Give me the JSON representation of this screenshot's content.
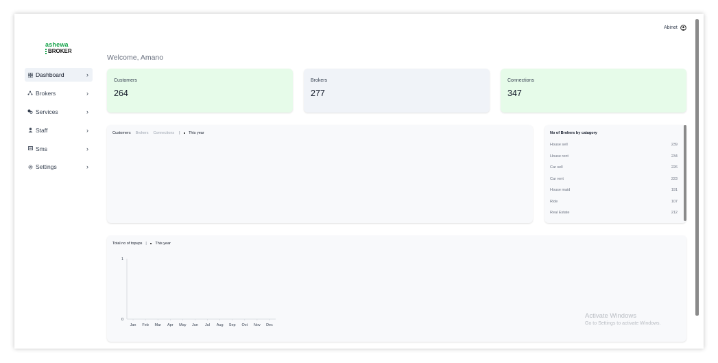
{
  "brand": {
    "top": "ashewa",
    "bottom": "BROKER",
    "accent": "#16a34a"
  },
  "user": {
    "name": "Abinet",
    "icon": "user-circle-icon"
  },
  "welcome": "Welcome, Amano",
  "sidebar": {
    "items": [
      {
        "label": "Dashboard",
        "icon": "grid-icon",
        "active": true
      },
      {
        "label": "Brokers",
        "icon": "branch-icon"
      },
      {
        "label": "Services",
        "icon": "services-icon"
      },
      {
        "label": "Staff",
        "icon": "person-icon"
      },
      {
        "label": "Sms",
        "icon": "message-icon"
      },
      {
        "label": "Settings",
        "icon": "gear-icon"
      }
    ]
  },
  "stats": [
    {
      "label": "Customers",
      "value": "264",
      "color": "#e6fbe9"
    },
    {
      "label": "Brokers",
      "value": "277",
      "color": "#f0f3f8"
    },
    {
      "label": "Connections",
      "value": "347",
      "color": "#e6fbe9"
    }
  ],
  "activity": {
    "tabs": [
      "Customers",
      "Brokers",
      "Connections"
    ],
    "period": "This year"
  },
  "categories": {
    "title": "No of Brokers by catagory",
    "rows": [
      {
        "name": "House sell",
        "count": "239"
      },
      {
        "name": "House rent",
        "count": "234"
      },
      {
        "name": "Car sell",
        "count": "226"
      },
      {
        "name": "Car rent",
        "count": "223"
      },
      {
        "name": "House maid",
        "count": "191"
      },
      {
        "name": "Ride",
        "count": "107"
      },
      {
        "name": "Real Estate",
        "count": "212"
      }
    ]
  },
  "topups": {
    "title": "Total no of topups",
    "period": "This year"
  },
  "chart_data": {
    "type": "line",
    "categories": [
      "Jan",
      "Feb",
      "Mar",
      "Apr",
      "May",
      "Jun",
      "Jul",
      "Aug",
      "Sep",
      "Oct",
      "Nov",
      "Dec"
    ],
    "series": [],
    "ylim": [
      0,
      1
    ],
    "yticks": [
      "0",
      "1"
    ],
    "grid": false
  },
  "watermark": {
    "line1": "Activate Windows",
    "line2": "Go to Settings to activate Windows."
  }
}
